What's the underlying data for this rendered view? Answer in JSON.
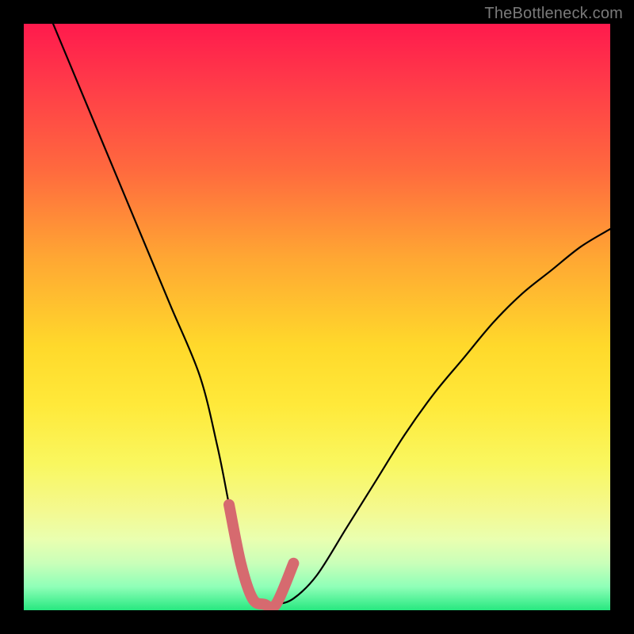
{
  "watermark": "TheBottleneck.com",
  "colors": {
    "background": "#000000",
    "curve": "#000000",
    "highlight_zone": "#d66a6f",
    "watermark_text": "#7a7a7a"
  },
  "chart_data": {
    "type": "line",
    "title": "",
    "xlabel": "",
    "ylabel": "",
    "xlim": [
      0,
      100
    ],
    "ylim": [
      0,
      100
    ],
    "series": [
      {
        "name": "bottleneck-curve",
        "x": [
          5,
          10,
          15,
          20,
          25,
          30,
          33,
          35,
          37,
          39,
          41,
          43,
          46,
          50,
          55,
          60,
          65,
          70,
          75,
          80,
          85,
          90,
          95,
          100
        ],
        "values": [
          100,
          88,
          76,
          64,
          52,
          40,
          28,
          18,
          8,
          2,
          1,
          1,
          2,
          6,
          14,
          22,
          30,
          37,
          43,
          49,
          54,
          58,
          62,
          65
        ]
      }
    ],
    "highlight_flat_bottom": {
      "x_start": 37,
      "x_end": 47,
      "y": 2
    },
    "gradient_stops": [
      {
        "pos": 0.0,
        "color": "#ff1a4d"
      },
      {
        "pos": 0.55,
        "color": "#ffd92b"
      },
      {
        "pos": 0.85,
        "color": "#f4f990"
      },
      {
        "pos": 1.0,
        "color": "#27e880"
      }
    ]
  }
}
